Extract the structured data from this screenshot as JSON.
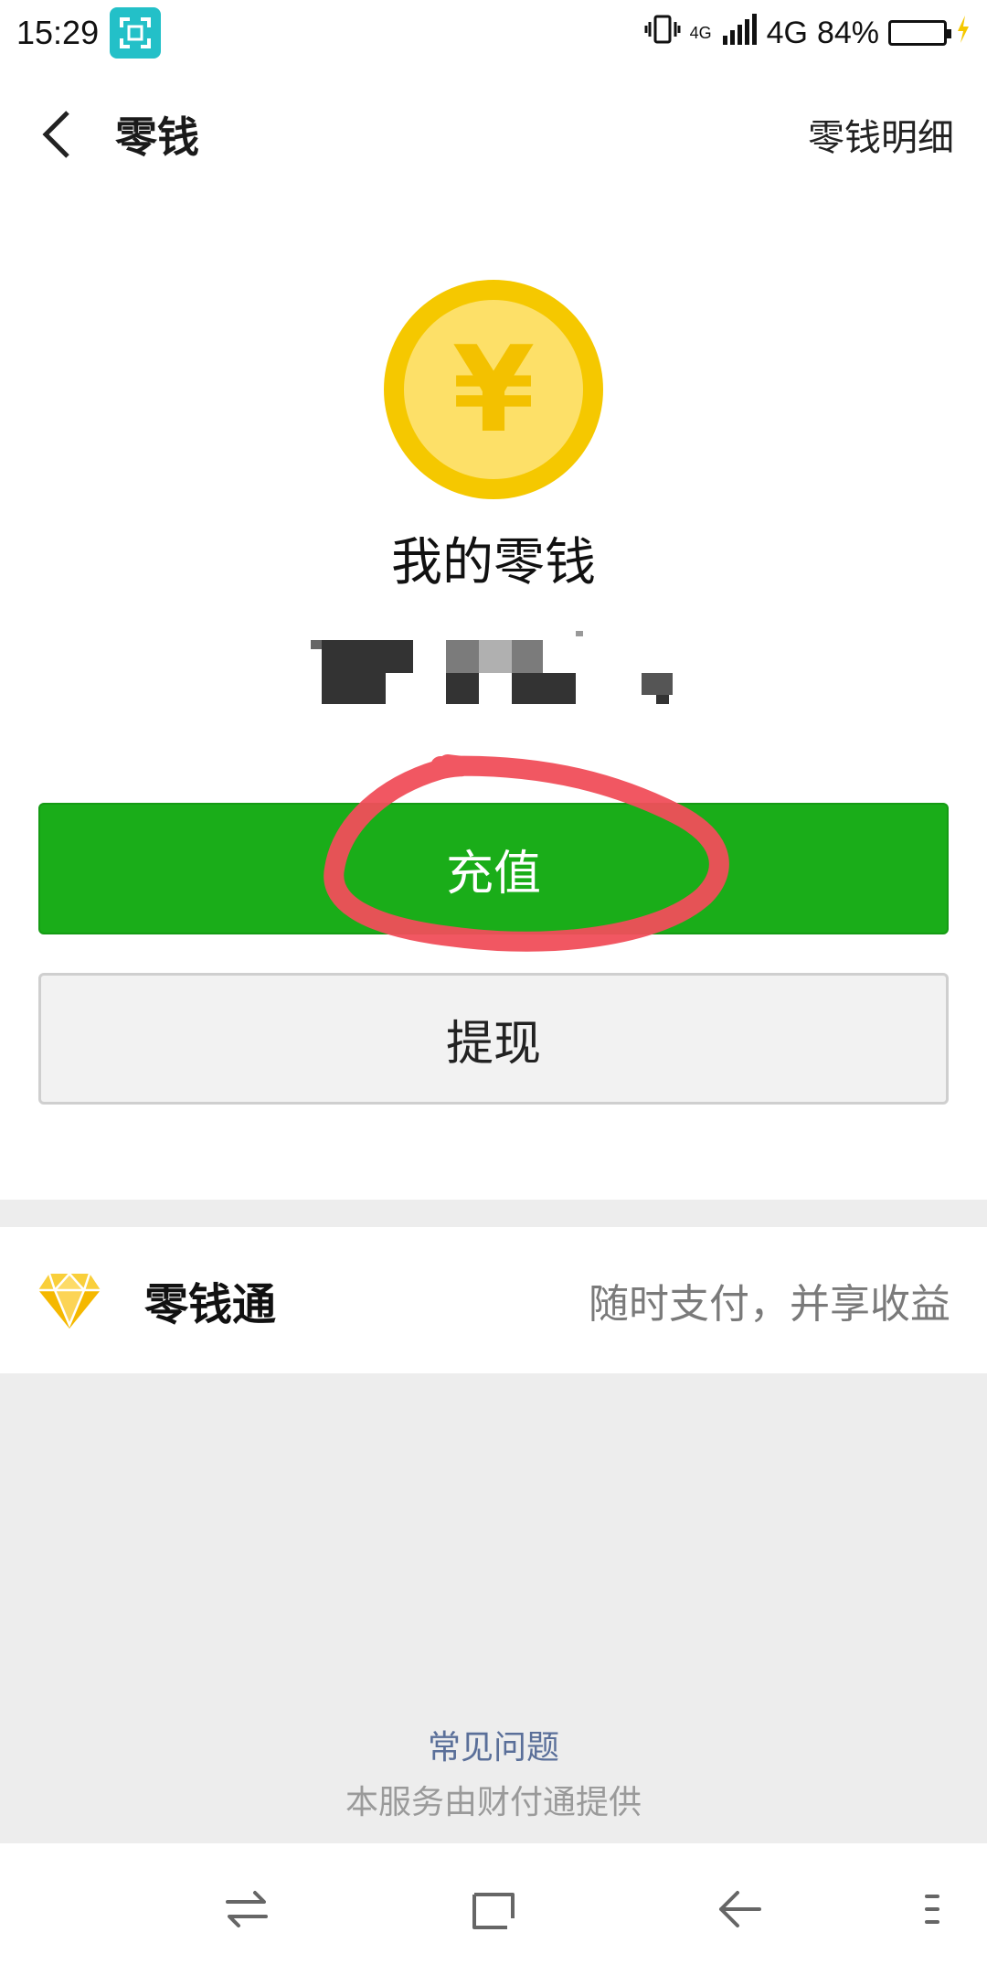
{
  "status_bar": {
    "time": "15:29",
    "network_small": "4G",
    "network": "4G",
    "battery": "84%",
    "battery_level": 0.84
  },
  "header": {
    "title": "零钱",
    "detail_link": "零钱明细",
    "back_icon": "chevron-left-icon"
  },
  "wallet": {
    "icon": "yuan-coin-icon",
    "currency_symbol": "¥",
    "title": "我的零钱",
    "balance": ""
  },
  "actions": {
    "recharge": "充值",
    "withdraw": "提现"
  },
  "lingqiantong": {
    "icon": "diamond-icon",
    "label": "零钱通",
    "description": "随时支付，并享收益"
  },
  "footer": {
    "faq": "常见问题",
    "provider": "本服务由财付通提供"
  },
  "system_nav": {
    "icons": [
      "switch-app-icon",
      "home-icon",
      "back-icon",
      "menu-icon"
    ]
  },
  "colors": {
    "primary_green": "#1aad19",
    "coin_gold": "#f5c800",
    "annotation_red": "#f04e5a",
    "link_blue": "#5a6f99"
  }
}
